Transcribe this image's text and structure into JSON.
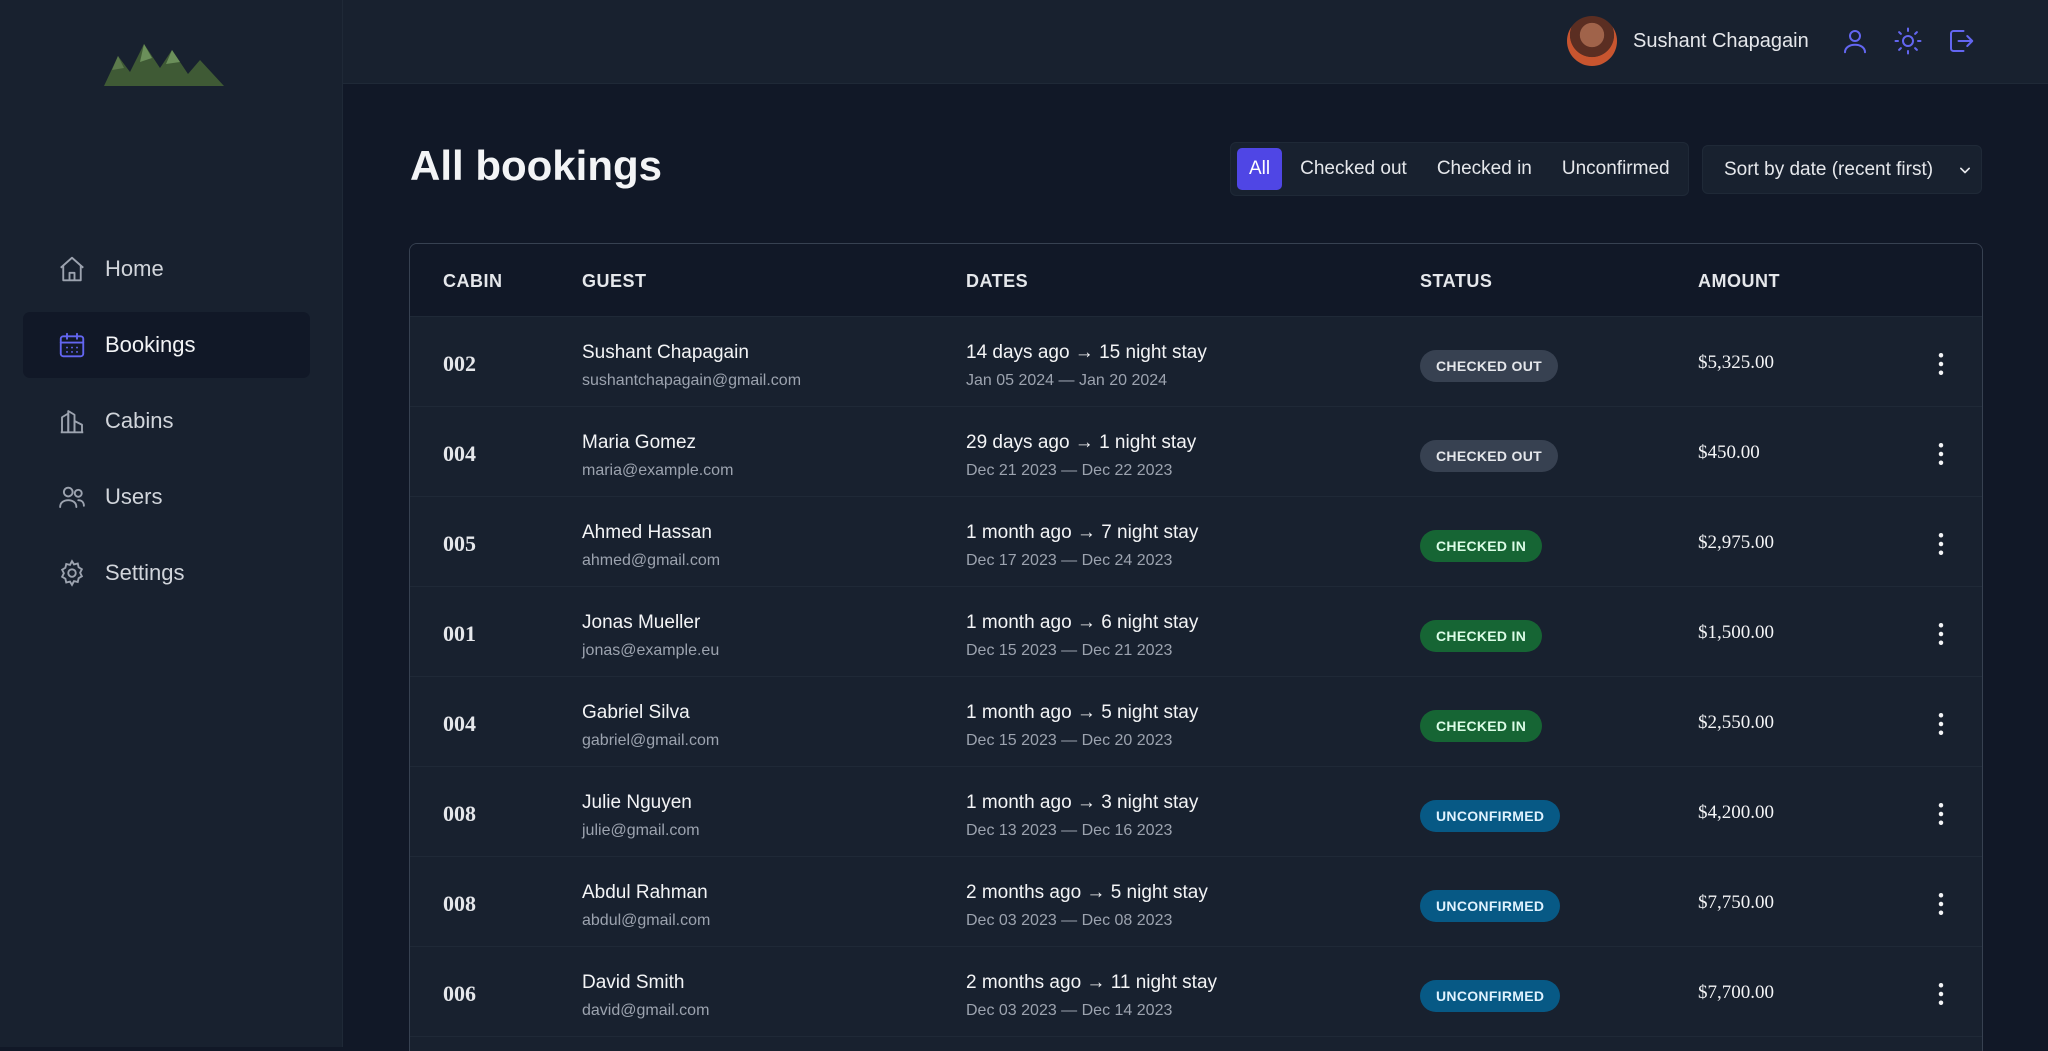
{
  "sidebar": {
    "nav": [
      {
        "label": "Home",
        "icon": "home-icon"
      },
      {
        "label": "Bookings",
        "icon": "calendar-icon",
        "active": true
      },
      {
        "label": "Cabins",
        "icon": "cabins-icon"
      },
      {
        "label": "Users",
        "icon": "users-icon"
      },
      {
        "label": "Settings",
        "icon": "gear-icon"
      }
    ]
  },
  "header": {
    "user_name": "Sushant Chapagain",
    "icons": [
      "user-icon",
      "sun-icon",
      "logout-icon"
    ]
  },
  "main": {
    "title": "All bookings",
    "filters": [
      "All",
      "Checked out",
      "Checked in",
      "Unconfirmed"
    ],
    "active_filter": "All",
    "sort_label": "Sort by date (recent first)"
  },
  "table": {
    "headers": [
      "CABIN",
      "GUEST",
      "DATES",
      "STATUS",
      "AMOUNT"
    ],
    "rows": [
      {
        "cabin": "002",
        "name": "Sushant Chapagain",
        "email": "sushantchapagain@gmail.com",
        "when": "14 days ago → 15 night stay",
        "range": "Jan 05 2024 — Jan 20 2024",
        "status": "CHECKED OUT",
        "amount": "$5,325.00"
      },
      {
        "cabin": "004",
        "name": "Maria Gomez",
        "email": "maria@example.com",
        "when": "29 days ago → 1 night stay",
        "range": "Dec 21 2023 — Dec 22 2023",
        "status": "CHECKED OUT",
        "amount": "$450.00"
      },
      {
        "cabin": "005",
        "name": "Ahmed Hassan",
        "email": "ahmed@gmail.com",
        "when": "1 month ago → 7 night stay",
        "range": "Dec 17 2023 — Dec 24 2023",
        "status": "CHECKED IN",
        "amount": "$2,975.00"
      },
      {
        "cabin": "001",
        "name": "Jonas Mueller",
        "email": "jonas@example.eu",
        "when": "1 month ago → 6 night stay",
        "range": "Dec 15 2023 — Dec 21 2023",
        "status": "CHECKED IN",
        "amount": "$1,500.00"
      },
      {
        "cabin": "004",
        "name": "Gabriel Silva",
        "email": "gabriel@gmail.com",
        "when": "1 month ago → 5 night stay",
        "range": "Dec 15 2023 — Dec 20 2023",
        "status": "CHECKED IN",
        "amount": "$2,550.00"
      },
      {
        "cabin": "008",
        "name": "Julie Nguyen",
        "email": "julie@gmail.com",
        "when": "1 month ago → 3 night stay",
        "range": "Dec 13 2023 — Dec 16 2023",
        "status": "UNCONFIRMED",
        "amount": "$4,200.00"
      },
      {
        "cabin": "008",
        "name": "Abdul Rahman",
        "email": "abdul@gmail.com",
        "when": "2 months ago → 5 night stay",
        "range": "Dec 03 2023 — Dec 08 2023",
        "status": "UNCONFIRMED",
        "amount": "$7,750.00"
      },
      {
        "cabin": "006",
        "name": "David Smith",
        "email": "david@gmail.com",
        "when": "2 months ago → 11 night stay",
        "range": "Dec 03 2023 — Dec 14 2023",
        "status": "UNCONFIRMED",
        "amount": "$7,700.00"
      }
    ]
  },
  "colors": {
    "background": "#111827",
    "panel": "#18212f",
    "accent": "#4f46e5",
    "checked_out": "#374151",
    "checked_in": "#166534",
    "unconfirmed": "#075985"
  }
}
